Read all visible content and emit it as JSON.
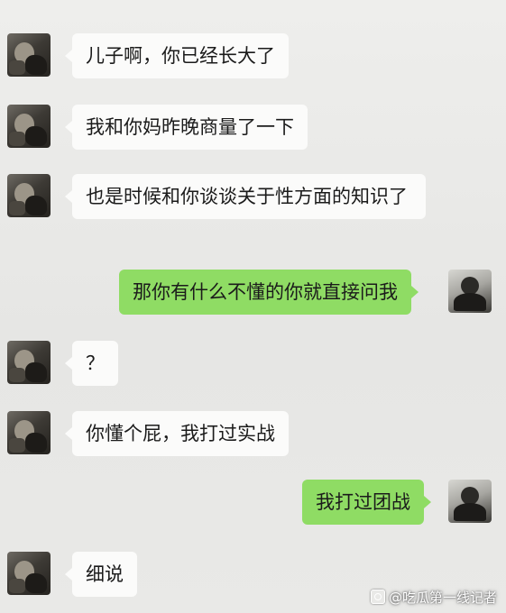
{
  "messages": [
    {
      "side": "left",
      "text": "儿子啊，你已经长大了"
    },
    {
      "side": "left",
      "text": "我和你妈昨晚商量了一下"
    },
    {
      "side": "left",
      "text": "也是时候和你谈谈关于性方面的知识了"
    },
    {
      "side": "right",
      "text": "那你有什么不懂的你就直接问我"
    },
    {
      "side": "left",
      "text": "？"
    },
    {
      "side": "left",
      "text": "你懂个屁，我打过实战"
    },
    {
      "side": "right",
      "text": "我打过团战"
    },
    {
      "side": "left",
      "text": "细说"
    }
  ],
  "watermark": {
    "text": "@吃瓜第一线记者",
    "icon": "weibo-logo-icon"
  },
  "colors": {
    "background": "#e9e9e7",
    "left_bubble": "#fbfbfa",
    "right_bubble": "#8fdc64"
  }
}
